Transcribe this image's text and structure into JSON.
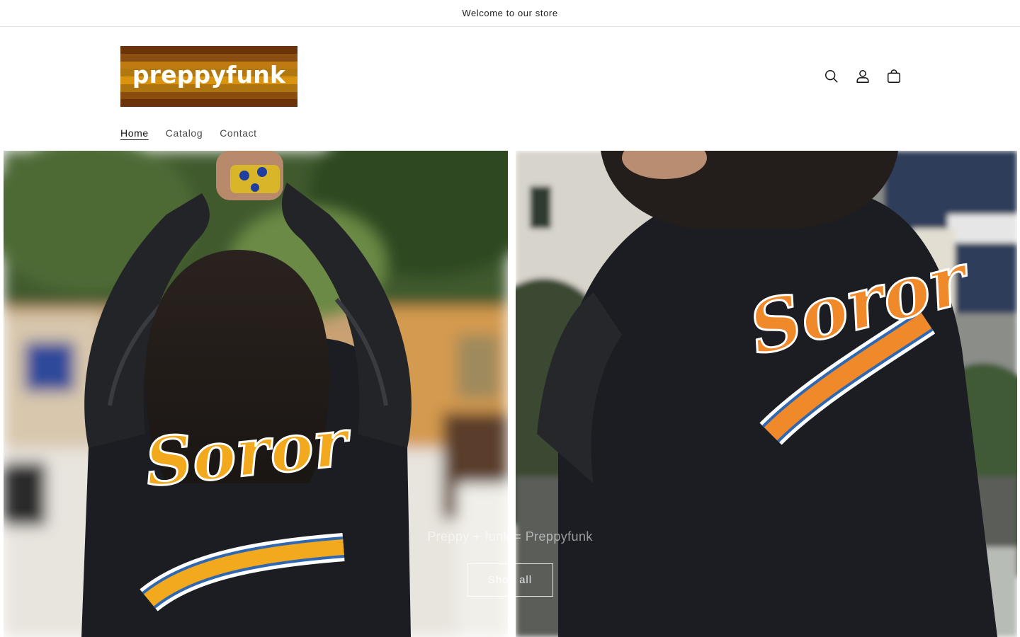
{
  "announcement": {
    "text": "Welcome to our store"
  },
  "header": {
    "logo_text": "preppyfunk",
    "logo_stripes": [
      "#6b3408",
      "#8a4d12",
      "#c07a12",
      "#b0780f",
      "#d9930f",
      "#ad7410",
      "#8b4d0f",
      "#6b3408"
    ],
    "icons": [
      {
        "name": "search-icon"
      },
      {
        "name": "account-icon"
      },
      {
        "name": "cart-icon"
      }
    ]
  },
  "nav": {
    "items": [
      "Home",
      "Catalog",
      "Contact"
    ],
    "active": "Home"
  },
  "hero": {
    "caption": "Preppy + funk = Preppyfunk",
    "button_label": "Shop all",
    "left_patch_text": "Soror",
    "right_patch_text": "Soror",
    "colors": {
      "jacket": "#1c1d22",
      "patch_left": "#f2a91d",
      "patch_right": "#f0892a",
      "trim_blue": "#2f68b0"
    }
  }
}
